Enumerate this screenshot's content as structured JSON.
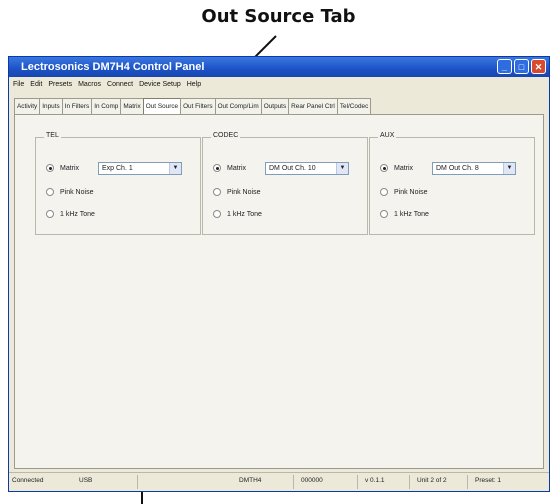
{
  "callout": {
    "label": "Out Source Tab"
  },
  "window": {
    "title": "Lectrosonics DM7H4 Control Panel"
  },
  "menu": [
    "File",
    "Edit",
    "Presets",
    "Macros",
    "Connect",
    "Device Setup",
    "Help"
  ],
  "tabs": [
    "Activity",
    "Inputs",
    "In Filters",
    "In Comp",
    "Matrix",
    "Out Source",
    "Out Filters",
    "Out Comp/Lim",
    "Outputs",
    "Rear Panel Ctrl",
    "Tel/Codec"
  ],
  "active_tab": "Out Source",
  "groups": [
    {
      "label": "TEL",
      "options": [
        "Matrix",
        "Pink Noise",
        "1 kHz Tone"
      ],
      "selected": "Matrix",
      "combo_value": "Exp Ch. 1"
    },
    {
      "label": "CODEC",
      "options": [
        "Matrix",
        "Pink Noise",
        "1 kHz Tone"
      ],
      "selected": "Matrix",
      "combo_value": "DM Out Ch. 10"
    },
    {
      "label": "AUX",
      "options": [
        "Matrix",
        "Pink Noise",
        "1 kHz Tone"
      ],
      "selected": "Matrix",
      "combo_value": "DM Out Ch. 8"
    }
  ],
  "status": {
    "connection": "Connected",
    "port": "USB",
    "device": "DMTH4",
    "serial": "000000",
    "version": "v 0.1.1",
    "unit": "Unit 2 of 2",
    "preset": "Preset: 1"
  }
}
